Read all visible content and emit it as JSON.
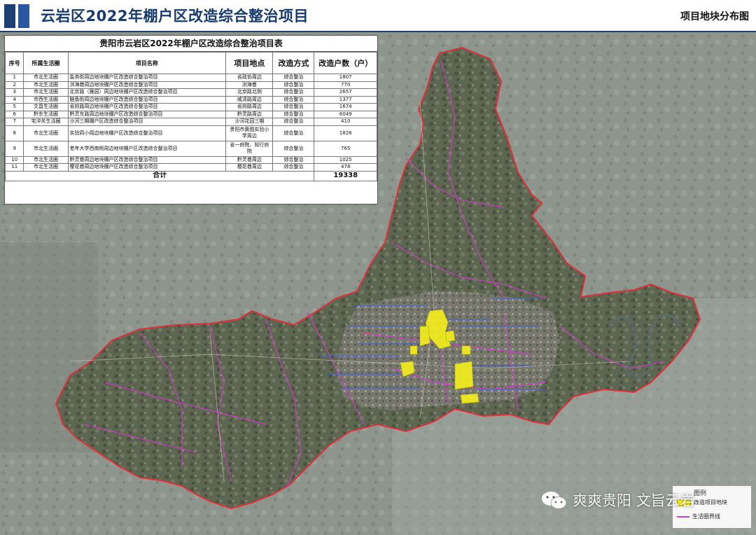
{
  "header": {
    "title": "云岩区2022年棚户区改造综合整治项目",
    "right_label": "项目地块分布图"
  },
  "table": {
    "title": "贵阳市云岩区2022年棚户区改造综合整治项目表",
    "columns": [
      "序号",
      "所属生活圈",
      "项目名称",
      "项目地点",
      "改造方式",
      "改造户数（户）"
    ],
    "rows": [
      {
        "no": "1",
        "circle": "市北生活圈",
        "name": "盐务街周边地块棚户区改造综合整治项目",
        "location": "省政协周边",
        "method": "综合整治",
        "households": "1807"
      },
      {
        "no": "2",
        "circle": "市北生活圈",
        "name": "浏海巷周边地块棚户区改造综合整治项目",
        "location": "浏海巷",
        "method": "综合整治",
        "households": "770"
      },
      {
        "no": "3",
        "circle": "市北生活圈",
        "name": "北京路（雅园）周边地块棚户区改造综合整治项目",
        "location": "北京路北侧",
        "method": "综合整治",
        "households": "2657"
      },
      {
        "no": "4",
        "circle": "市西生活圈",
        "name": "鲢鱼街周边地块棚户区改造综合整治项目",
        "location": "威清路周边",
        "method": "综合整治",
        "households": "1377"
      },
      {
        "no": "5",
        "circle": "文昌生活圈",
        "name": "省府路周边地块棚户区改造综合整治项目",
        "location": "省府路周边",
        "method": "综合整治",
        "households": "1674"
      },
      {
        "no": "6",
        "circle": "黔东生活圈",
        "name": "黔灵东路周边地块棚户区改造综合整治项目",
        "location": "黔灵路周边",
        "method": "综合整治",
        "households": "6049"
      },
      {
        "no": "7",
        "circle": "宅沖关生活圈",
        "name": "沙河三期棚户区改造综合整治项目",
        "location": "沙河花园三期",
        "method": "综合整治",
        "households": "410"
      },
      {
        "no": "8",
        "circle": "市北生活圈",
        "name": "实验四小周边地块棚户区改造综合整治项目",
        "location": "贵阳市黄图实验小学周边",
        "method": "综合整治",
        "households": "1826"
      },
      {
        "no": "9",
        "circle": "市北生活圈",
        "name": "老年大学西南侧周边地块棚户区改造综合整治项目",
        "location": "省一府院、知行府院",
        "method": "综合整治",
        "households": "765"
      },
      {
        "no": "10",
        "circle": "市北生活圈",
        "name": "黔灵巷周边地块棚户区改造综合整治项目",
        "location": "黔灵巷周边",
        "method": "综合整治",
        "households": "1025"
      },
      {
        "no": "11",
        "circle": "市北生活圈",
        "name": "樱花巷周边地块棚户区改造综合整治项目",
        "location": "樱花巷周边",
        "method": "综合整治",
        "households": "478"
      }
    ],
    "total_label": "合计",
    "total_value": "19338"
  },
  "legend": {
    "title": "图例",
    "items": [
      {
        "label": "改造项目地块",
        "color": "#f3ee1d"
      },
      {
        "label": "生活圈界线",
        "color": "#d23ad0"
      }
    ]
  },
  "watermark": {
    "text": "爽爽贵阳 文旨云岩",
    "icon": "wechat-icon"
  },
  "colors": {
    "header_blue": "#1e3f73",
    "district_boundary": "#e0303a",
    "circle_line": "#d23ad0",
    "project_parcel": "#f3ee1d"
  }
}
